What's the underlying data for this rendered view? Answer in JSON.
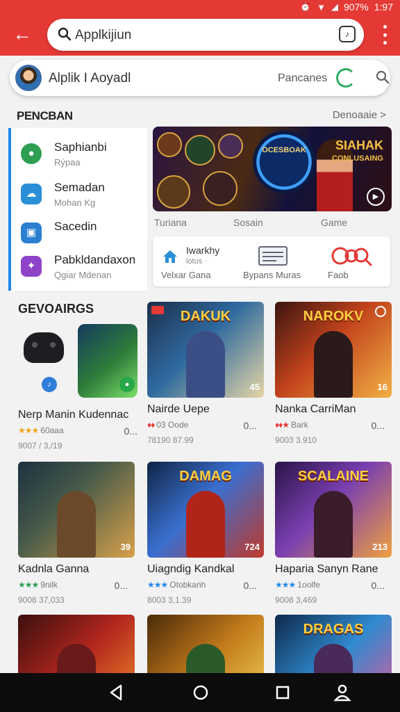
{
  "status": {
    "battery": "907%",
    "time": "1:97"
  },
  "topbar": {
    "query": "Applkijiun"
  },
  "subbar": {
    "title": "Alplik I Aoyadl",
    "filter": "Pancanes"
  },
  "section": {
    "title": "PENCBAN",
    "link": "Denoaaie >"
  },
  "categories": [
    {
      "label": "Saphianbi",
      "sub": "Rýpaa",
      "color": "#2e9e52",
      "icon": "chat-icon"
    },
    {
      "label": "Semadan",
      "sub": "Mohan Kg",
      "color": "#2a8fd6",
      "icon": "cloud-icon"
    },
    {
      "label": "Sacedin",
      "sub": "",
      "color": "#2a7fd0",
      "icon": "briefcase-icon"
    },
    {
      "label": "Pabkldandaxon",
      "sub": "Qgiar Mdenan",
      "color": "#8e44c9",
      "icon": "gamepad-icon"
    }
  ],
  "banner": {
    "orb_text": "OCESBOAK",
    "title": "SIAHAK",
    "subtitle": "CONLUSAING"
  },
  "banner_labels": [
    "Turiana",
    "Sosain",
    "Game"
  ],
  "quick_tiles": [
    {
      "title": "Iwarkhy",
      "sub": "lotus ·",
      "label": "Velxar Gana",
      "icon": "home-icon"
    },
    {
      "title": "",
      "sub": "",
      "label": "Bypans Muras",
      "icon": "document-icon"
    },
    {
      "title": "",
      "sub": "",
      "label": "Faob",
      "icon": "search-icon"
    }
  ],
  "games_heading": "GEVOAIRGS",
  "games": [
    {
      "name": "Nerp Manin Kudennac",
      "stars": "★★★",
      "star_color": "#f2a31b",
      "rating": "60aaa",
      "price": "9007 / 3,/19",
      "more": "0...",
      "logo": "",
      "num": "",
      "grad": ""
    },
    {
      "name": "Nairde Uepe",
      "stars": "♦♦",
      "star_color": "#e53935",
      "rating": "03 Oode",
      "price": "78190 87.99",
      "more": "0...",
      "logo": "DAKUK",
      "num": "45",
      "grad": "linear-gradient(135deg,#1c2f4a,#2f6aa0 45%,#e6d6a6)",
      "hero": "#3b4f86"
    },
    {
      "name": "Nanka CarriMan",
      "stars": "♦♦★",
      "star_color": "#e53935",
      "rating": "Bark",
      "price": "9003 3.910",
      "more": "0...",
      "logo": "NAROKV",
      "num": "16",
      "grad": "linear-gradient(135deg,#3a1410,#c2431c 45%,#f2b045)",
      "hero": "#2a1a1a"
    },
    {
      "name": "Kadnla Ganna",
      "stars": "★★★",
      "star_color": "#2e9e52",
      "rating": "9nilk",
      "price": "9008 37,033",
      "more": "0...",
      "logo": "",
      "num": "39",
      "grad": "linear-gradient(135deg,#1e3040,#455a4a 40%,#d9a04a)",
      "hero": "#6a4a2a"
    },
    {
      "name": "Uiagndig Kandkal",
      "stars": "★★★",
      "star_color": "#1e88e5",
      "rating": "Otobkanh",
      "price": "8003 3,1.39",
      "more": "0...",
      "logo": "DAMAG",
      "num": "724",
      "grad": "linear-gradient(135deg,#0f2444,#3a6fd0 45%,#c0392b)",
      "hero": "#b0241a"
    },
    {
      "name": "Haparia Sanyn Rane",
      "stars": "★★★",
      "star_color": "#1e88e5",
      "rating": "1oolfe",
      "price": "9008 3,469",
      "more": "0...",
      "logo": "SCALAINE",
      "num": "213",
      "grad": "linear-gradient(135deg,#2a1448,#7a3fb0 45%,#f0a040)",
      "hero": "#3a1c2a"
    },
    {
      "name": "",
      "stars": "",
      "star_color": "#000",
      "rating": "",
      "price": "",
      "more": "",
      "logo": "",
      "num": "",
      "grad": "linear-gradient(135deg,#3a0f0f,#b3261e 50%,#f08a2a)",
      "hero": "#6a1a1a"
    },
    {
      "name": "",
      "stars": "",
      "star_color": "#000",
      "rating": "",
      "price": "",
      "more": "",
      "logo": "",
      "num": "",
      "grad": "linear-gradient(135deg,#4a2a0a,#c27a1a 50%,#f2d05a)",
      "hero": "#2a5a2a"
    },
    {
      "name": "",
      "stars": "",
      "star_color": "#000",
      "rating": "",
      "price": "",
      "more": "",
      "logo": "DRAGAS",
      "num": "",
      "grad": "linear-gradient(135deg,#0f2a4a,#2f8ad0 50%,#e05a9a)",
      "hero": "#4a2a5a"
    }
  ],
  "colors": {
    "brand": "#e53935",
    "accent": "#1e88e5"
  }
}
